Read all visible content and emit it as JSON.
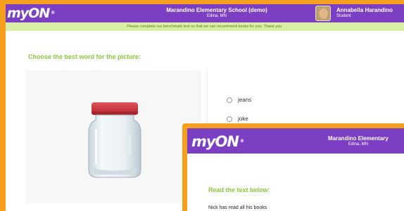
{
  "app": {
    "logo_text": "myON",
    "logo_mark": "®"
  },
  "header": {
    "school_name": "Marandino Elementary School (demo)",
    "school_location": "Edina, MN",
    "user_name": "Annabella Harandino",
    "user_role": "Student"
  },
  "banner": {
    "text": "Please complete our benchmark test so that we can recommend books for you. Thank you."
  },
  "question": {
    "prompt": "Choose the best word for the picture:",
    "picture_icon": "jar-icon",
    "options": [
      "jeans",
      "joke"
    ]
  },
  "second_window": {
    "school_name": "Marandino Elementary",
    "school_location": "Edina, MN",
    "prompt": "Read the text below:",
    "text": "Nick has read all his books"
  },
  "colors": {
    "frame": "#f59f1f",
    "header": "#7c3fc4",
    "banner": "#d9efa6",
    "accent_green": "#8cc63f",
    "jar_lid": "#c9343a"
  }
}
